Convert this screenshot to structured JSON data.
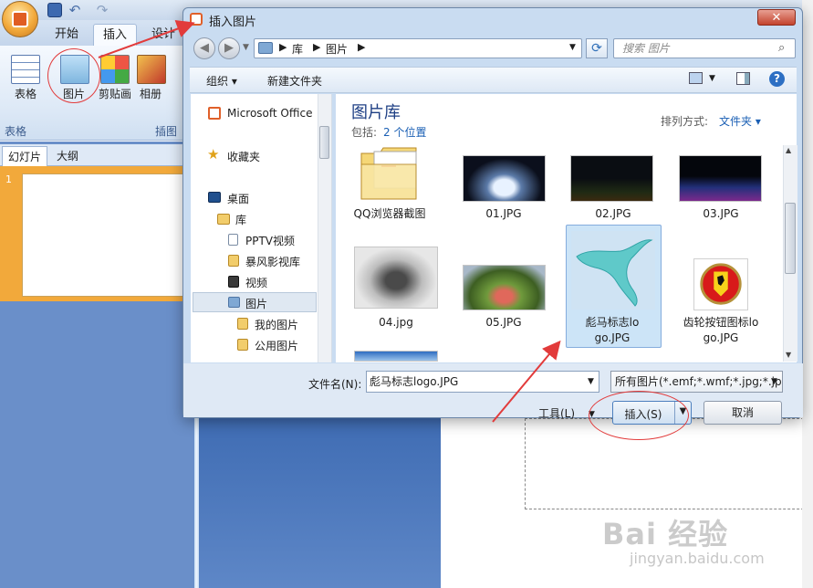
{
  "powerpoint": {
    "tabs": [
      "开始",
      "插入",
      "设计"
    ],
    "ribbon": {
      "table_label": "表格",
      "picture_label": "图片",
      "clipart_label": "剪贴画",
      "album_label": "相册",
      "group_table": "表格",
      "group_illustrations": "插图"
    },
    "slide_tabs": [
      "幻灯片",
      "大纲"
    ],
    "slide_number": "1"
  },
  "dialog": {
    "title": "插入图片",
    "close": "✕",
    "address": [
      "库",
      "图片"
    ],
    "search_placeholder": "搜索 图片",
    "toolbar": {
      "organize": "组织 ▾",
      "new_folder": "新建文件夹",
      "help": "?"
    },
    "nav": [
      {
        "label": "Microsoft Office",
        "icon": "office-icon"
      },
      {
        "label": "收藏夹",
        "icon": "star-icon"
      },
      {
        "label": "桌面",
        "icon": "desktop-icon"
      },
      {
        "label": "库",
        "icon": "library-icon"
      },
      {
        "label": "PPTV视频",
        "icon": "document-icon"
      },
      {
        "label": "暴风影视库",
        "icon": "folder-icon"
      },
      {
        "label": "视频",
        "icon": "video-icon"
      },
      {
        "label": "图片",
        "icon": "pictures-icon"
      },
      {
        "label": "我的图片",
        "icon": "folder-icon"
      },
      {
        "label": "公用图片",
        "icon": "folder-icon"
      }
    ],
    "library": {
      "title": "图片库",
      "includes_label": "包括:",
      "includes_link": "2 个位置",
      "arrange_label": "排列方式:",
      "arrange_value": "文件夹 ▾"
    },
    "files": [
      {
        "name": "QQ浏览器截图"
      },
      {
        "name": "01.JPG"
      },
      {
        "name": "02.JPG"
      },
      {
        "name": "03.JPG"
      },
      {
        "name": "04.jpg"
      },
      {
        "name": "05.JPG"
      },
      {
        "name": "彪马标志logo.JPG",
        "selected": true
      },
      {
        "name": "齿轮按钮图标logo.JPG"
      }
    ],
    "filename_label": "文件名(N):",
    "filename_value": "彪马标志logo.JPG",
    "filetype_value": "所有图片(*.emf;*.wmf;*.jpg;*.jpeg;*.png)",
    "tools_label": "工具(L)",
    "insert_label": "插入(S)",
    "cancel_label": "取消"
  },
  "watermark": {
    "brand": "Bai 经验",
    "url": "jingyan.baidu.com"
  },
  "colors": {
    "accent": "#1e3f84",
    "link": "#1a5fb4",
    "annotation": "#e23b3b",
    "selection": "#cce4f7"
  }
}
